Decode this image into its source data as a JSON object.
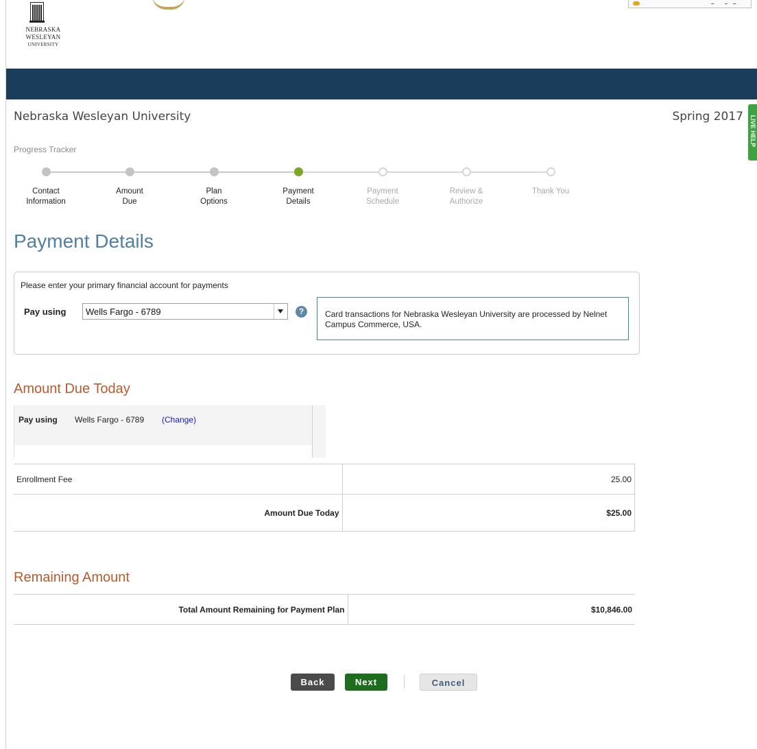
{
  "branding": {
    "logo_line1": "NEBRASKA",
    "logo_line2": "WESLEYAN",
    "logo_line3": "UNIVERSITY",
    "banner_color": "#1b3d5c"
  },
  "header": {
    "school_name": "Nebraska Wesleyan University",
    "term": "Spring 2017",
    "live_help": "LIVE HELP"
  },
  "tracker": {
    "label": "Progress Tracker",
    "steps": [
      {
        "line1": "Contact",
        "line2": "Information",
        "state": "done"
      },
      {
        "line1": "Amount",
        "line2": "Due",
        "state": "done"
      },
      {
        "line1": "Plan",
        "line2": "Options",
        "state": "done"
      },
      {
        "line1": "Payment",
        "line2": "Details",
        "state": "active"
      },
      {
        "line1": "Payment",
        "line2": "Schedule",
        "state": "todo"
      },
      {
        "line1": "Review &",
        "line2": "Authorize",
        "state": "todo"
      },
      {
        "line1": "Thank You",
        "line2": "",
        "state": "todo"
      }
    ],
    "active_color": "#7aa726"
  },
  "page_title": "Payment Details",
  "payment_details": {
    "intro": "Please enter your primary financial account for payments",
    "pay_using_label": "Pay using",
    "selected_account": "Wells Fargo - 6789",
    "help_icon": "?",
    "notice": "Card transactions for Nebraska Wesleyan University are processed by Nelnet Campus Commerce, USA."
  },
  "amount_due": {
    "heading": "Amount Due Today",
    "pay_using_label": "Pay using",
    "pay_using_value": "Wells Fargo - 6789",
    "change_link": "(Change)",
    "rows": [
      {
        "label": "Enrollment Fee",
        "value": "25.00"
      }
    ],
    "total_label": "Amount Due Today",
    "total_value": "$25.00"
  },
  "remaining": {
    "heading": "Remaining Amount",
    "label": "Total Amount Remaining for Payment Plan",
    "value": "$10,846.00"
  },
  "buttons": {
    "back": "Back",
    "next": "Next",
    "cancel": "Cancel"
  },
  "colors": {
    "heading_blue": "#4f7fa3",
    "heading_orange": "#b55b2e",
    "next_green": "#1e6d1e",
    "back_gray": "#4b4b4b",
    "link_blue": "#1515d4"
  }
}
